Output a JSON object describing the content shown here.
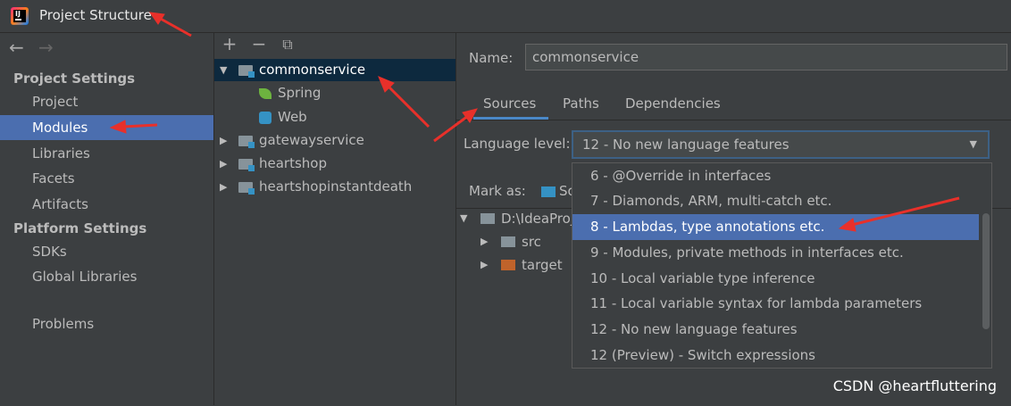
{
  "window": {
    "title": "Project Structure"
  },
  "nav": {
    "back_glyph": "←",
    "forward_glyph": "→",
    "project_settings_header": "Project Settings",
    "project_settings_items": [
      "Project",
      "Modules",
      "Libraries",
      "Facets",
      "Artifacts"
    ],
    "platform_settings_header": "Platform Settings",
    "platform_settings_items": [
      "SDKs",
      "Global Libraries"
    ],
    "problems": "Problems",
    "selected": "Modules"
  },
  "tree_toolbar": {
    "add": "+",
    "remove": "−",
    "copy": "⧉"
  },
  "module_tree": {
    "root": "commonservice",
    "children": [
      "Spring",
      "Web"
    ],
    "others": [
      "gatewayservice",
      "heartshop",
      "heartshopinstantdeath"
    ]
  },
  "details": {
    "name_label": "Name:",
    "name_value": "commonservice",
    "tabs": [
      "Sources",
      "Paths",
      "Dependencies"
    ],
    "active_tab": "Sources",
    "language_level_label": "Language level:",
    "language_level_value": "12 - No new language features",
    "mark_as_label": "Mark as:",
    "mark_as_partial": "So",
    "content_root": "D:\\IdeaProj",
    "content_children": [
      "src",
      "target"
    ]
  },
  "dropdown": {
    "options": [
      "6 - @Override in interfaces",
      "7 - Diamonds, ARM, multi-catch etc.",
      "8 - Lambdas, type annotations etc.",
      "9 - Modules, private methods in interfaces etc.",
      "10 - Local variable type inference",
      "11 - Local variable syntax for lambda parameters",
      "12 - No new language features",
      "12 (Preview) - Switch expressions"
    ],
    "highlighted": "8 - Lambdas, type annotations etc."
  },
  "watermark": "CSDN @heartfluttering",
  "colors": {
    "background": "#3c3f41",
    "selection": "#4b6eaf",
    "tree_selection": "#0d293e",
    "tab_accent": "#4a88c7",
    "annotation_arrow": "#e8302a"
  }
}
